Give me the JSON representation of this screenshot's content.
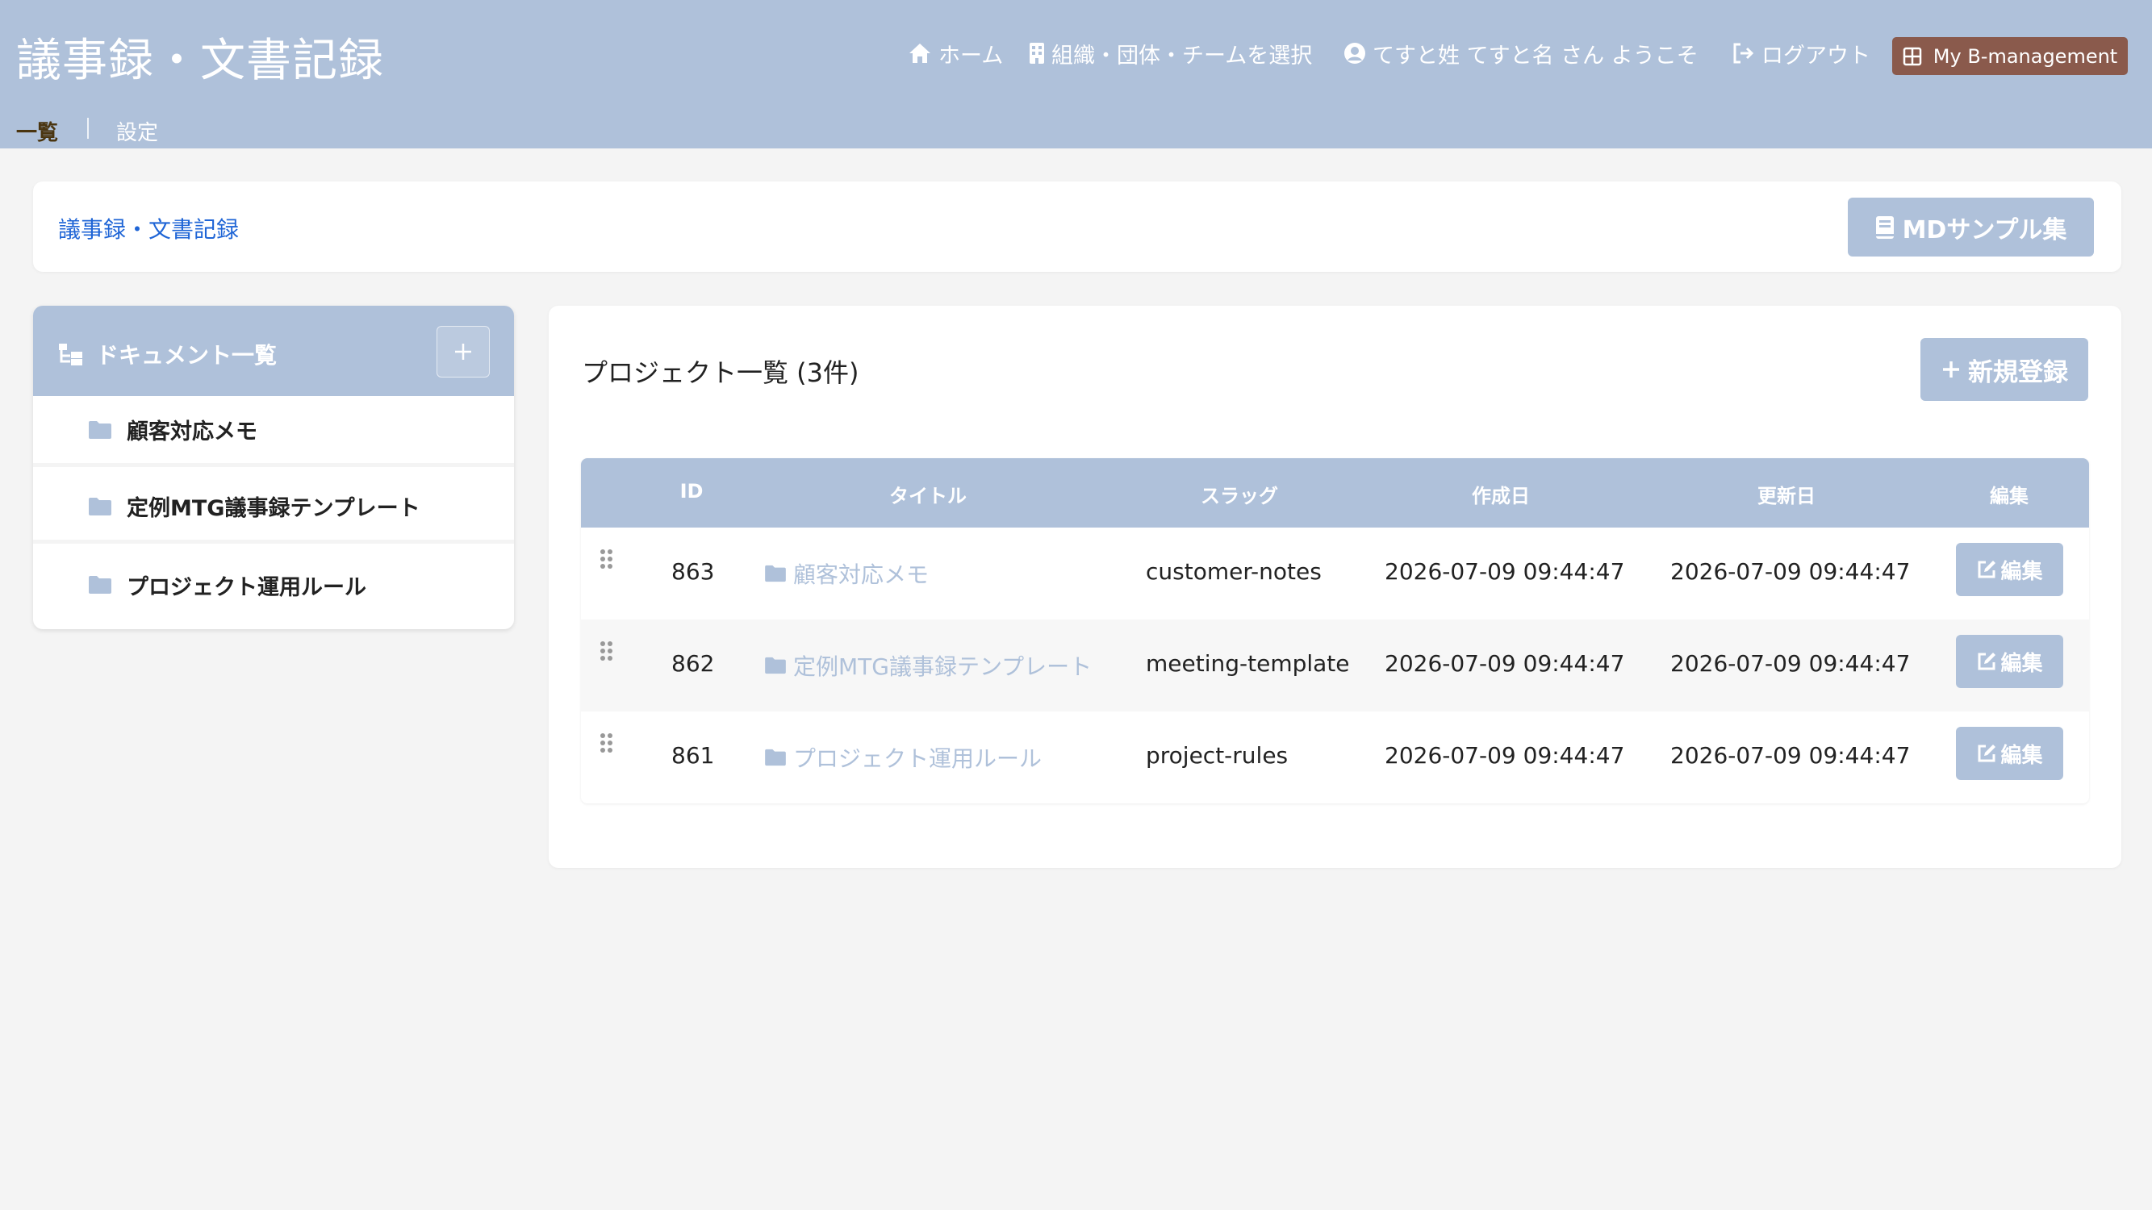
{
  "header": {
    "app_title": "議事録・文書記録",
    "nav": {
      "home": "ホーム",
      "select_org": "組織・団体・チームを選択",
      "welcome": "てすと姓 てすと名 さん ようこそ",
      "logout": "ログアウト",
      "my_bm": "My B-management"
    },
    "subnav": {
      "list": "一覧",
      "settings": "設定"
    }
  },
  "breadcrumb": {
    "label": "議事録・文書記録"
  },
  "md_samples_button": "MDサンプル集",
  "sidebar": {
    "title": "ドキュメント一覧",
    "items": [
      {
        "label": "顧客対応メモ"
      },
      {
        "label": "定例MTG議事録テンプレート"
      },
      {
        "label": "プロジェクト運用ルール"
      }
    ]
  },
  "main": {
    "title": "プロジェクト一覧 (3件)",
    "new_button": "新規登録",
    "table": {
      "headers": {
        "id": "ID",
        "title": "タイトル",
        "slug": "スラッグ",
        "created": "作成日",
        "updated": "更新日",
        "edit": "編集"
      },
      "rows": [
        {
          "id": "863",
          "title": "顧客対応メモ",
          "slug": "customer-notes",
          "created": "2026-07-09 09:44:47",
          "updated": "2026-07-09 09:44:47",
          "edit": "編集"
        },
        {
          "id": "862",
          "title": "定例MTG議事録テンプレート",
          "slug": "meeting-template",
          "created": "2026-07-09 09:44:47",
          "updated": "2026-07-09 09:44:47",
          "edit": "編集"
        },
        {
          "id": "861",
          "title": "プロジェクト運用ルール",
          "slug": "project-rules",
          "created": "2026-07-09 09:44:47",
          "updated": "2026-07-09 09:44:47",
          "edit": "編集"
        }
      ]
    }
  },
  "colors": {
    "header_bg": "#afc1da",
    "accent": "#afc1da",
    "my_bm_bg": "#8a5a4c",
    "link": "#1f65d6",
    "active_subnav": "#4a3510"
  }
}
